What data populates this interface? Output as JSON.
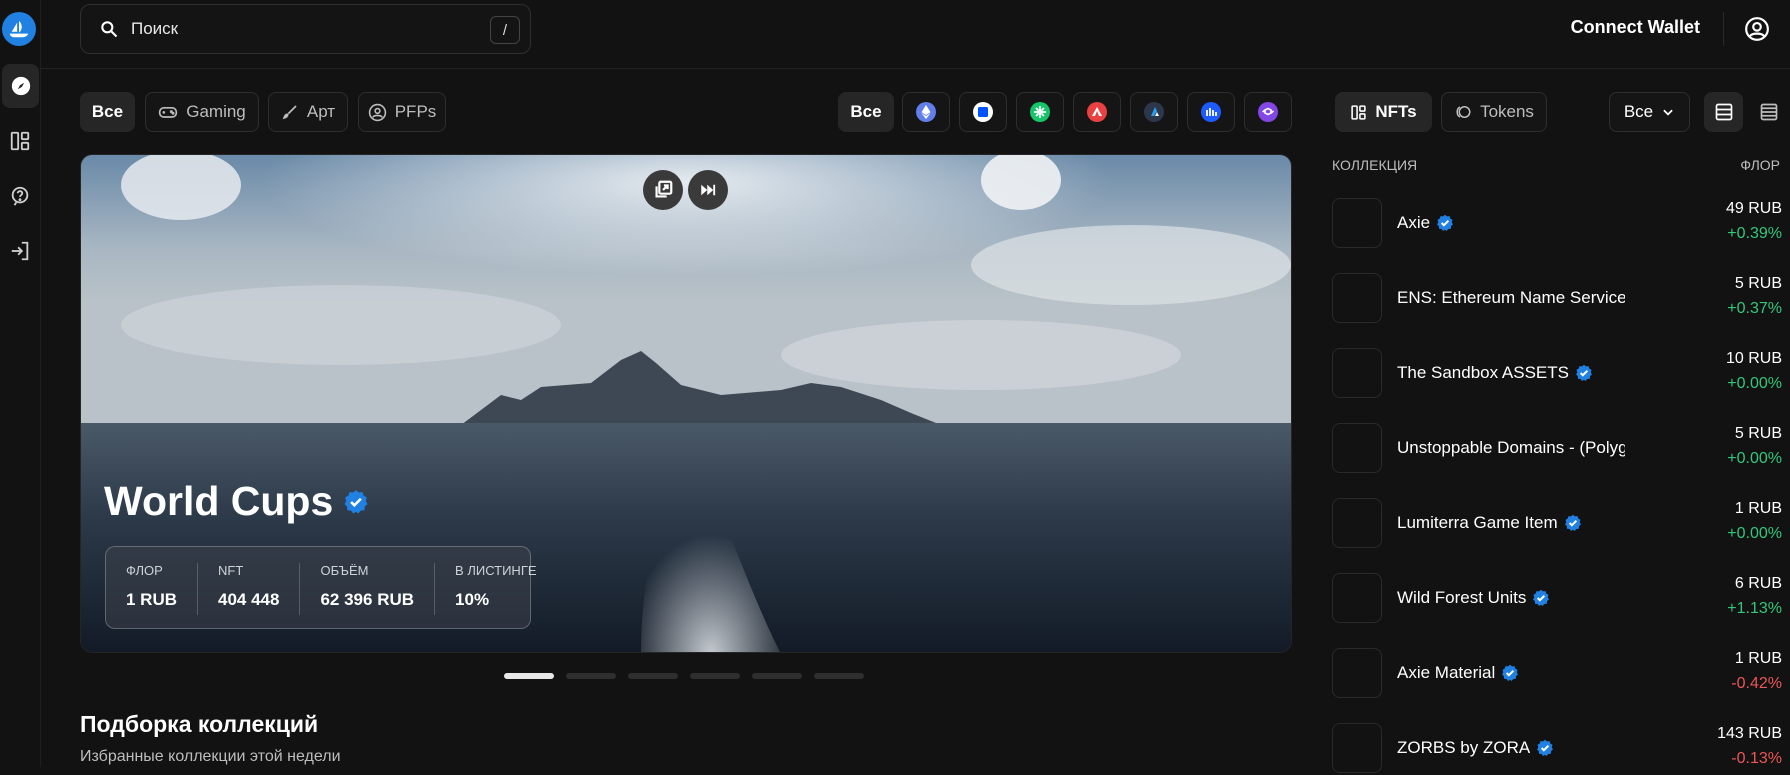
{
  "search": {
    "placeholder": "Поиск",
    "shortcut": "/"
  },
  "header": {
    "connect_label": "Connect Wallet"
  },
  "categories": [
    {
      "label": "Все",
      "active": true
    },
    {
      "label": "Gaming",
      "active": false
    },
    {
      "label": "Арт",
      "active": false
    },
    {
      "label": "PFPs",
      "active": false
    }
  ],
  "chains": {
    "all_label": "Все",
    "items": [
      {
        "icon": "ethereum-icon",
        "color": "#627eea"
      },
      {
        "icon": "square-chain-icon",
        "color": "#0052ff"
      },
      {
        "icon": "flower-chain-icon",
        "color": "#16c56a"
      },
      {
        "icon": "avalanche-icon",
        "color": "#e84142"
      },
      {
        "icon": "arbitrum-icon",
        "color": "#2d374b"
      },
      {
        "icon": "blast-icon",
        "color": "#1e5bff"
      },
      {
        "icon": "polygon-icon",
        "color": "#8247e5"
      }
    ]
  },
  "hero": {
    "title": "World Cups",
    "stats": [
      {
        "label": "ФЛОР",
        "value": "1 RUB"
      },
      {
        "label": "NFT",
        "value": "404 448"
      },
      {
        "label": "ОБЪЁМ",
        "value": "62 396 RUB"
      },
      {
        "label": "В ЛИСТИНГЕ",
        "value": "10%"
      }
    ],
    "slides_total": 6,
    "active_slide": 1
  },
  "section": {
    "title": "Подборка коллекций",
    "subtitle": "Избранные коллекции этой недели"
  },
  "right_panel": {
    "tabs": [
      {
        "label": "NFTs",
        "active": true
      },
      {
        "label": "Tokens",
        "active": false
      }
    ],
    "filter_label": "Все",
    "col_collection": "КОЛЛЕКЦИЯ",
    "col_floor": "ФЛОР",
    "rows": [
      {
        "name": "Axie",
        "verified": true,
        "price": "49 RUB",
        "change": "+0.39%",
        "dir": "pos"
      },
      {
        "name": "ENS: Ethereum Name Service",
        "verified": false,
        "price": "5 RUB",
        "change": "+0.37%",
        "dir": "pos"
      },
      {
        "name": "The Sandbox ASSETS",
        "verified": true,
        "price": "10 RUB",
        "change": "+0.00%",
        "dir": "pos"
      },
      {
        "name": "Unstoppable Domains - (Polygon)",
        "verified": false,
        "price": "5 RUB",
        "change": "+0.00%",
        "dir": "pos"
      },
      {
        "name": "Lumiterra Game Item",
        "verified": true,
        "price": "1 RUB",
        "change": "+0.00%",
        "dir": "pos"
      },
      {
        "name": "Wild Forest Units",
        "verified": true,
        "price": "6 RUB",
        "change": "+1.13%",
        "dir": "pos"
      },
      {
        "name": "Axie Material",
        "verified": true,
        "price": "1 RUB",
        "change": "-0.42%",
        "dir": "neg"
      },
      {
        "name": "ZORBS by ZORA",
        "verified": true,
        "price": "143 RUB",
        "change": "-0.13%",
        "dir": "neg"
      }
    ]
  }
}
